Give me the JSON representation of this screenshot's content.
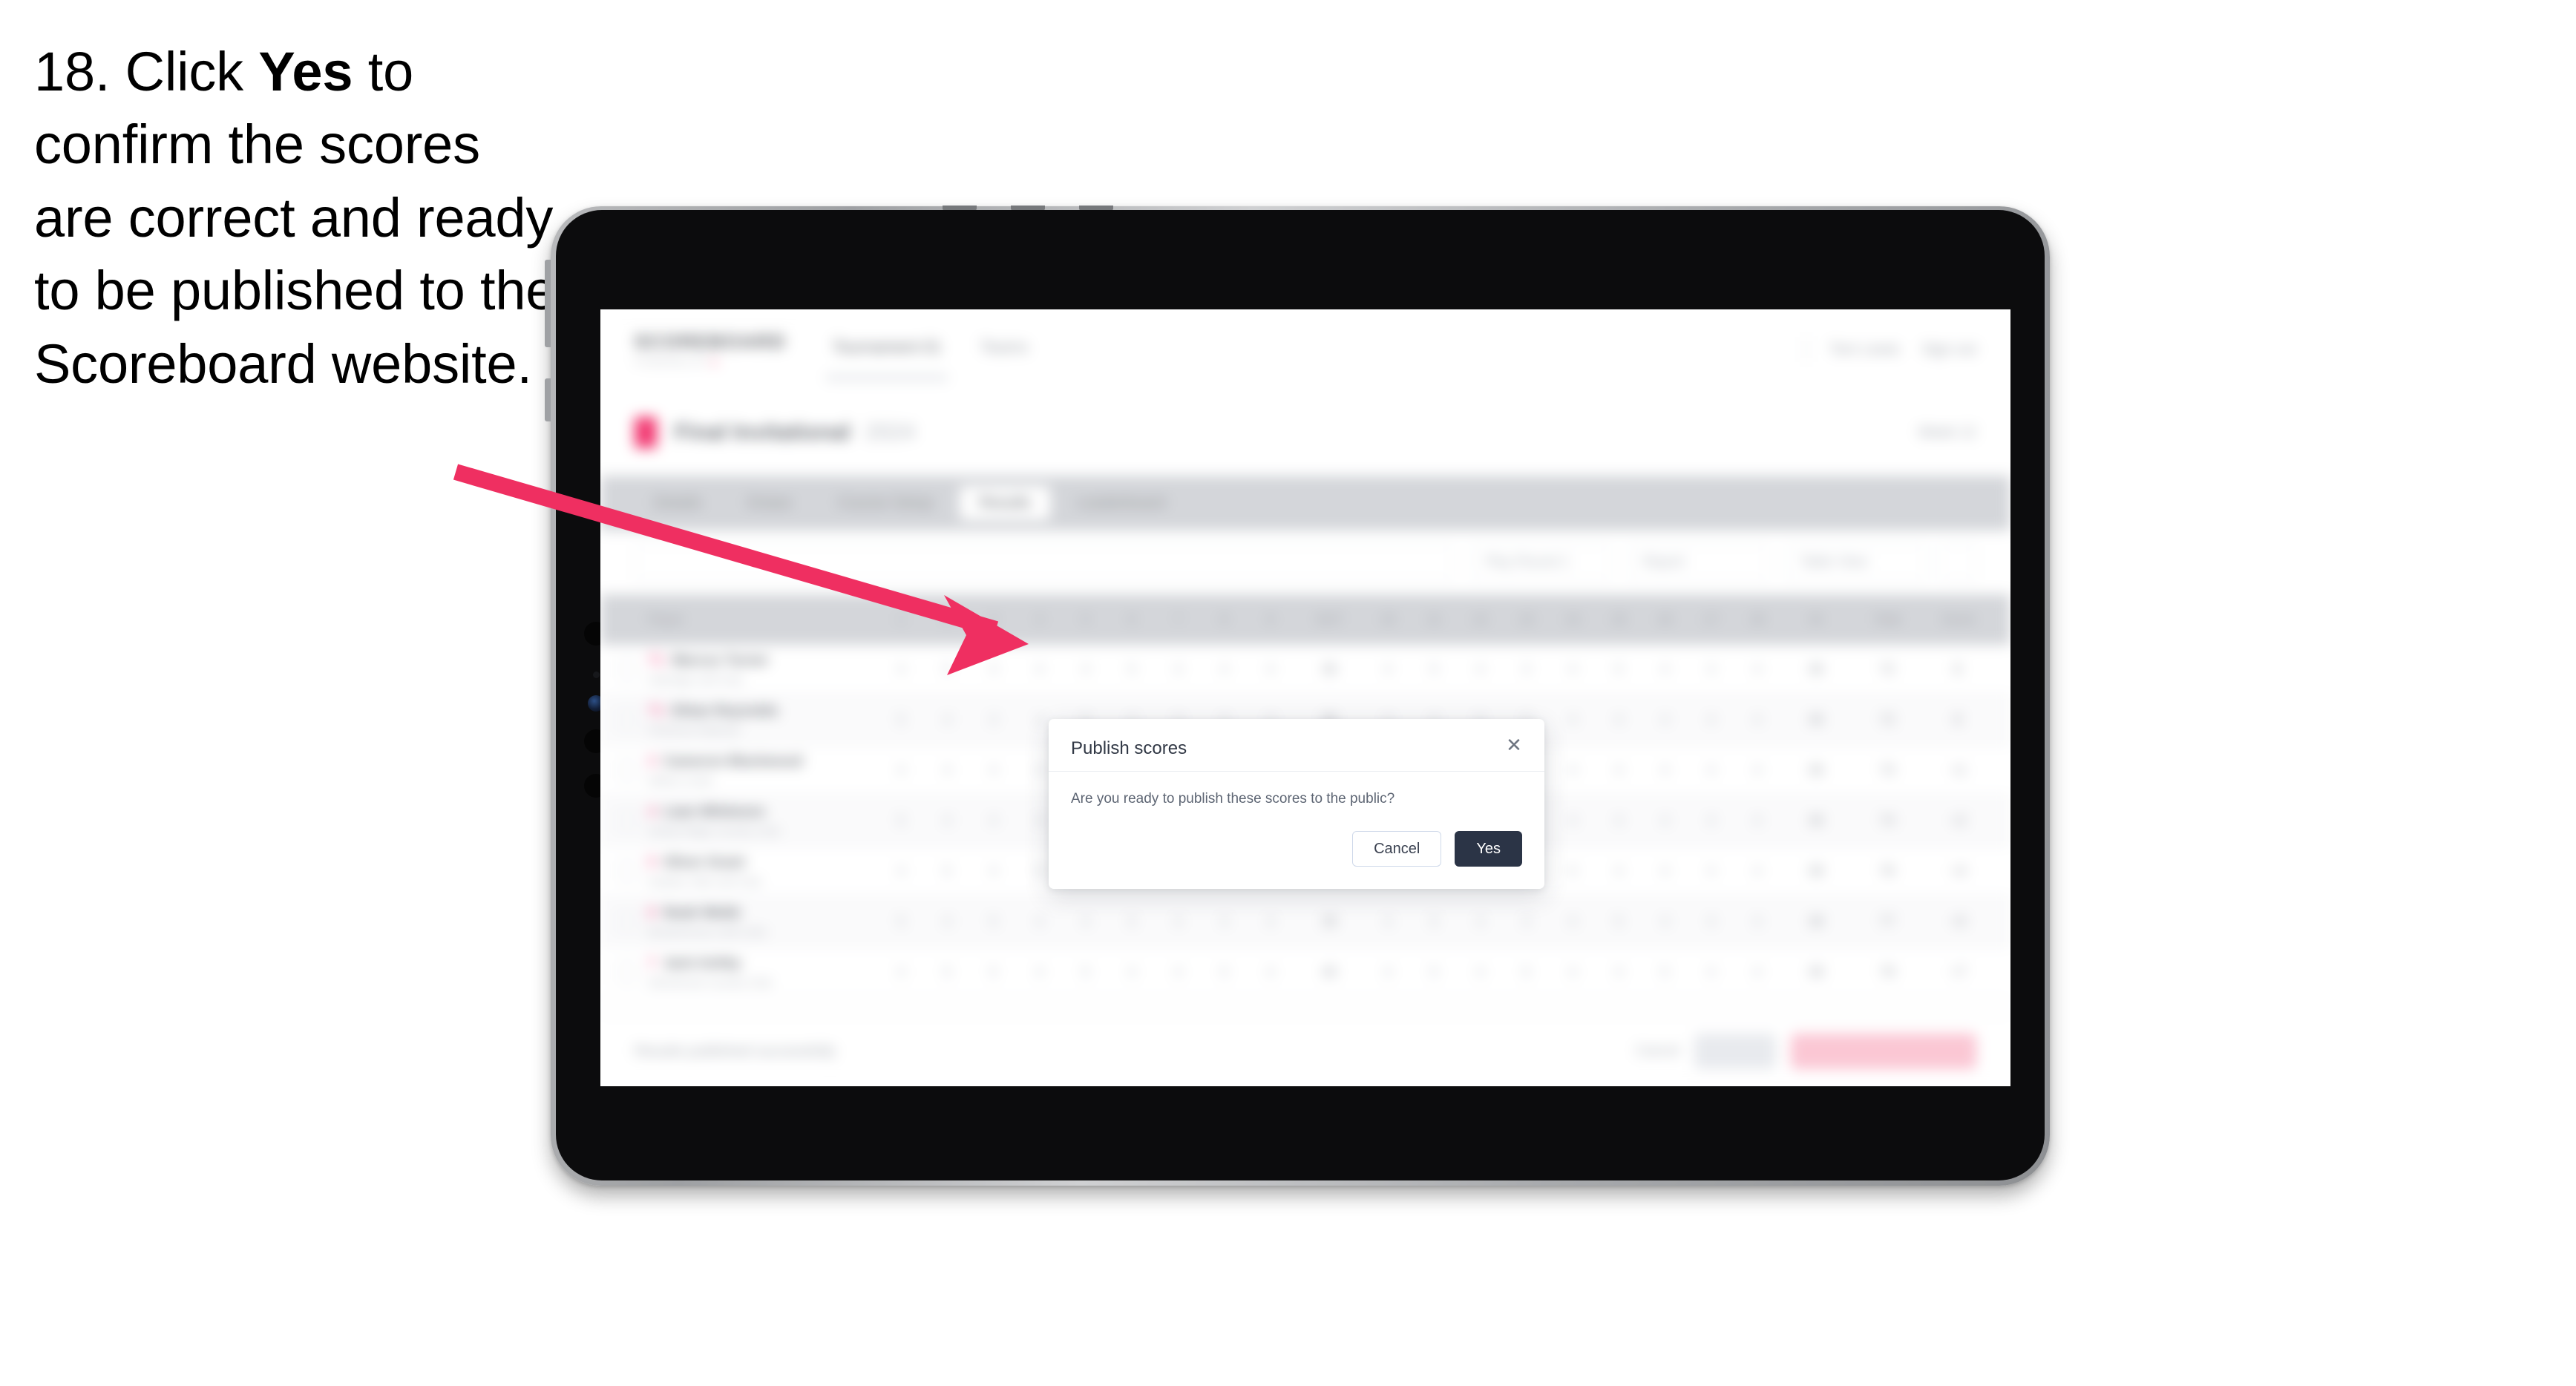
{
  "instruction": {
    "number": "18.",
    "before": "Click",
    "emphasis": "Yes",
    "after": "to confirm the scores are correct and ready to be published to the Scoreboard website."
  },
  "annotation": {
    "arrow_color": "#ef2f61",
    "arrow_name": "pointer-arrow",
    "points_to": "Yes"
  },
  "device": {
    "type": "tablet",
    "frame_color": "#a8aaad",
    "body_color": "#0c0c0d"
  },
  "app": {
    "brand": {
      "name": "SCOREBOARD",
      "tagline": "POWERED BY",
      "tagline_accent": "●"
    },
    "nav_links": [
      {
        "label": "Tournament 01"
      },
      {
        "label": "Teams"
      }
    ],
    "nav_right": [
      {
        "label": "Tom Lewis"
      },
      {
        "label": "Sign out"
      }
    ],
    "event": {
      "title": "Final Invitational",
      "subtitle": "2024",
      "right_label": "Week 12"
    },
    "tabs": [
      {
        "label": "Details",
        "selected": false
      },
      {
        "label": "Draws",
        "selected": false
      },
      {
        "label": "Course Setup",
        "selected": false
      },
      {
        "label": "Results",
        "selected": true
      },
      {
        "label": "Leaderboard",
        "selected": false
      }
    ],
    "toolbar": {
      "search_placeholder": "Search players",
      "filter_round": "Play Round 1",
      "filter_report": "Report",
      "filter_view": "Table View",
      "settings_icon": "gear-icon"
    },
    "table": {
      "columns": [
        "Player",
        "1",
        "2",
        "3",
        "4",
        "5",
        "6",
        "7",
        "8",
        "9",
        "OUT",
        "10",
        "11",
        "12",
        "13",
        "14",
        "15",
        "16",
        "17",
        "18",
        "IN",
        "Total",
        "Score"
      ],
      "rows": [
        {
          "rank": "T1",
          "name": "Marcus Turner",
          "club": "Oakridge Golf Club",
          "scores": [
            "4",
            "5",
            "3",
            "4",
            "4",
            "5",
            "3",
            "4",
            "4"
          ],
          "out": "36",
          "scores_in": [
            "4",
            "5",
            "4",
            "3",
            "4",
            "5",
            "4",
            "3",
            "4"
          ],
          "in": "36",
          "total": "72",
          "score": "E"
        },
        {
          "rank": "T1",
          "name": "Ethan Reynolds",
          "club": "Pinehurst National",
          "scores": [
            "5",
            "4",
            "3",
            "4",
            "5",
            "4",
            "3",
            "4",
            "4"
          ],
          "out": "36",
          "scores_in": [
            "4",
            "4",
            "5",
            "3",
            "4",
            "4",
            "4",
            "4",
            "4"
          ],
          "in": "36",
          "total": "72",
          "score": "E"
        },
        {
          "rank": "3",
          "name": "Cameron Blackwood",
          "club": "Willow Creek",
          "scores": [
            "4",
            "4",
            "4",
            "4",
            "4",
            "5",
            "3",
            "4",
            "5"
          ],
          "out": "37",
          "scores_in": [
            "4",
            "5",
            "4",
            "3",
            "4",
            "4",
            "4",
            "4",
            "4"
          ],
          "in": "36",
          "total": "73",
          "score": "+1"
        },
        {
          "rank": "4",
          "name": "Liam Whitmore",
          "club": "Sandy Ridge Country Club",
          "scores": [
            "5",
            "4",
            "4",
            "4",
            "4",
            "4",
            "4",
            "4",
            "5"
          ],
          "out": "38",
          "scores_in": [
            "4",
            "4",
            "4",
            "4",
            "4",
            "4",
            "4",
            "4",
            "4"
          ],
          "in": "36",
          "total": "74",
          "score": "+2"
        },
        {
          "rank": "5",
          "name": "Oliver Grant",
          "club": "Heather Hills Golf Club",
          "scores": [
            "4",
            "5",
            "4",
            "5",
            "4",
            "4",
            "4",
            "4",
            "4"
          ],
          "out": "38",
          "scores_in": [
            "5",
            "4",
            "4",
            "4",
            "5",
            "4",
            "4",
            "4",
            "4"
          ],
          "in": "38",
          "total": "76",
          "score": "+4"
        },
        {
          "rank": "6",
          "name": "Noah Webb",
          "club": "Brackenmoor Golf Links",
          "scores": [
            "5",
            "4",
            "5",
            "4",
            "4",
            "5",
            "4",
            "4",
            "4"
          ],
          "out": "39",
          "scores_in": [
            "4",
            "5",
            "4",
            "4",
            "4",
            "5",
            "4",
            "4",
            "4"
          ],
          "in": "38",
          "total": "77",
          "score": "+5"
        },
        {
          "rank": "7",
          "name": "Jack Ashby",
          "club": "Silverbrook Country Club",
          "scores": [
            "4",
            "5",
            "5",
            "4",
            "5",
            "4",
            "4",
            "5",
            "4"
          ],
          "out": "40",
          "scores_in": [
            "4",
            "5",
            "4",
            "5",
            "4",
            "4",
            "5",
            "4",
            "4"
          ],
          "in": "39",
          "total": "79",
          "score": "+7"
        }
      ]
    },
    "footer": {
      "note": "Results published successfully",
      "cancel_label": "Cancel",
      "save_label": "Save",
      "publish_label": "Publish to Scoreboard"
    }
  },
  "modal": {
    "title": "Publish scores",
    "close_icon": "close-icon",
    "message": "Are you ready to publish these scores to the public?",
    "cancel_label": "Cancel",
    "confirm_label": "Yes",
    "confirm_color": "#2b3446"
  }
}
